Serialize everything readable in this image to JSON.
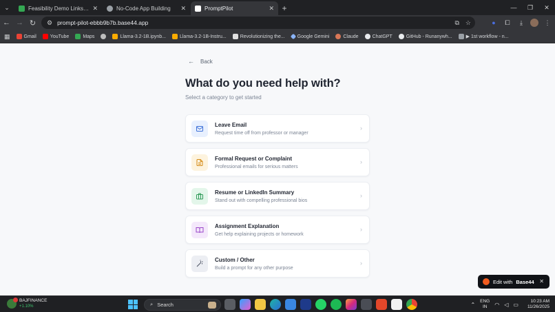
{
  "browser": {
    "tabs": [
      {
        "title": "Feasibility Demo Links/Prototyp",
        "favicon_color": "#34a853",
        "active": false
      },
      {
        "title": "No-Code App Building",
        "favicon_color": "#9aa0a6",
        "active": false
      },
      {
        "title": "PromptPilot",
        "favicon_color": "#ffffff",
        "active": true
      }
    ],
    "url": "prompt-pilot-ebbb9b7b.base44.app",
    "bookmarks": [
      {
        "label": "Gmail",
        "color": "#ea4335"
      },
      {
        "label": "YouTube",
        "color": "#ff0000"
      },
      {
        "label": "Maps",
        "color": "#34a853"
      },
      {
        "label": "",
        "color": "#bdbdbd"
      },
      {
        "label": "Llama-3.2-1B.ipynb...",
        "color": "#f9ab00"
      },
      {
        "label": "Llama-3.2-1B-Instru...",
        "color": "#f9ab00"
      },
      {
        "label": "Revolutionizing the...",
        "color": "#e0e0e0"
      },
      {
        "label": "Google Gemini",
        "color": "#8ab4f8"
      },
      {
        "label": "Claude",
        "color": "#d97757"
      },
      {
        "label": "ChatGPT",
        "color": "#e8eaed"
      },
      {
        "label": "GitHub - Runanywh...",
        "color": "#e8eaed"
      },
      {
        "label": "▶ 1st workflow - n...",
        "color": "#9aa0a6"
      }
    ]
  },
  "page": {
    "back_label": "Back",
    "title": "What do you need help with?",
    "subtitle": "Select a category to get started",
    "categories": [
      {
        "title": "Leave Email",
        "description": "Request time off from professor or manager",
        "icon": "mail-icon",
        "icon_bg": "#e8f0fe",
        "icon_color": "#3b6fd8"
      },
      {
        "title": "Formal Request or Complaint",
        "description": "Professional emails for serious matters",
        "icon": "document-icon",
        "icon_bg": "#fdf3de",
        "icon_color": "#d48a14"
      },
      {
        "title": "Resume or LinkedIn Summary",
        "description": "Stand out with compelling professional bios",
        "icon": "briefcase-icon",
        "icon_bg": "#e3f6ea",
        "icon_color": "#2f9a58"
      },
      {
        "title": "Assignment Explanation",
        "description": "Get help explaining projects or homework",
        "icon": "book-icon",
        "icon_bg": "#f4e8fb",
        "icon_color": "#9a45c8"
      },
      {
        "title": "Custom / Other",
        "description": "Build a prompt for any other purpose",
        "icon": "magic-wand-icon",
        "icon_bg": "#eceef3",
        "icon_color": "#4a5060"
      }
    ],
    "edit_badge": {
      "prefix": "Edit with",
      "brand": "Base44"
    }
  },
  "taskbar": {
    "ticker_symbol": "BAJFINANCE",
    "ticker_change": "+1.10%",
    "search_label": "Search",
    "lang_line1": "ENG",
    "lang_line2": "IN",
    "time": "10:23 AM",
    "date": "11/26/2025"
  }
}
